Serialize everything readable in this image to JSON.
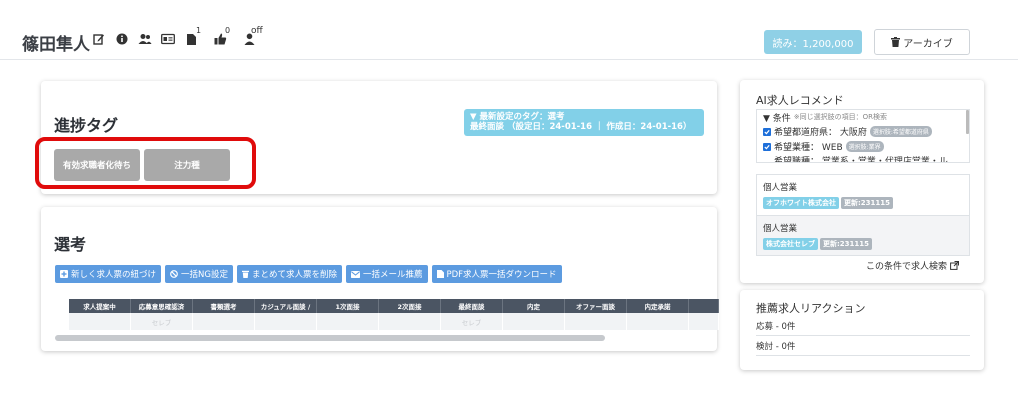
{
  "header": {
    "name": "篠田隼人",
    "icons": [
      "edit-icon",
      "info-icon",
      "users-icon",
      "id-card-icon",
      "document-icon",
      "thumbs-up-icon",
      "person-icon"
    ],
    "doc_count": "1",
    "like_count": "0",
    "status": "off",
    "read_button": "読み：1,200,000",
    "archive_button": "アーカイブ"
  },
  "progress": {
    "title": "進捗タグ",
    "info_line1": "▼ 最新設定のタグ：選考",
    "info_line2": "最終面談 （設定日：24-01-16 ｜ 作成日：24-01-16）",
    "tags": [
      "有効求職者化待ち",
      "注力種"
    ],
    "highlight_color": "#e00b0b"
  },
  "selection": {
    "title": "選考",
    "actions": [
      "新しく求人票の紐づけ",
      "一括NG設定",
      "まとめて求人票を削除",
      "一括メール推薦",
      "PDF求人票一括ダウンロード"
    ],
    "columns": [
      "求人提案中",
      "応募意思確認済",
      "書類選考",
      "カジュアル面談 /",
      "1次面接",
      "2次面接",
      "最終面談",
      "内定",
      "オファー面談",
      "内定承諾",
      ""
    ],
    "row": [
      "",
      "セレブ",
      "",
      "",
      "",
      "",
      "セレブ",
      "",
      "",
      "",
      ""
    ]
  },
  "ai": {
    "title": "AI求人レコメンド",
    "condition_header": "▼ 条件",
    "condition_note": "※同じ選択肢の項目：OR検索",
    "conditions": [
      {
        "label": "希望都道府県： 大阪府",
        "badge": "選択肢:希望都道府県"
      },
      {
        "label": "希望業種： WEB",
        "badge": "選択肢:業界"
      },
      {
        "label": "希望職種： 営業系・営業・代理店営業・ル",
        "badge": ""
      }
    ],
    "recommendations": [
      {
        "title": "個人営業",
        "company": "オフホワイト株式会社",
        "updated": "更新:231115"
      },
      {
        "title": "個人営業",
        "company": "株式会社セレブ",
        "updated": "更新:231115"
      }
    ],
    "search_link": "この条件で求人検索"
  },
  "reactions": {
    "title": "推薦求人リアクション",
    "applied": "応募 - 0件",
    "considering": "検討 - 0件"
  }
}
